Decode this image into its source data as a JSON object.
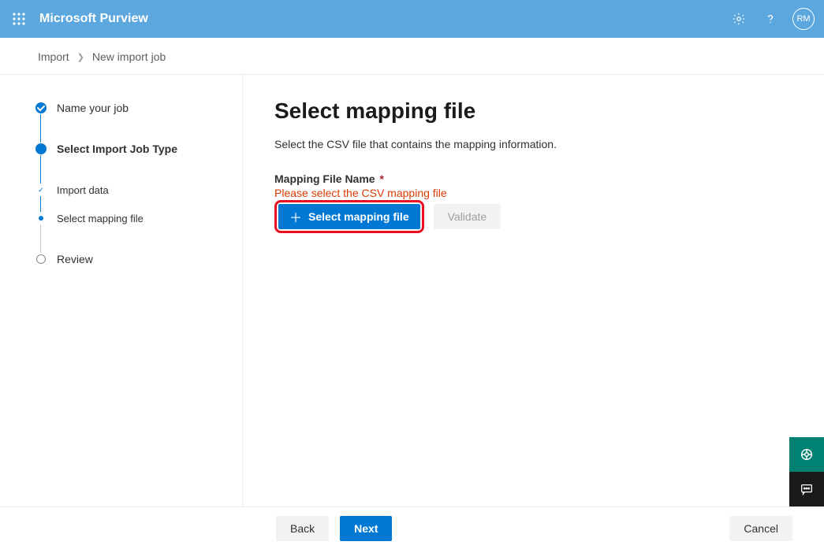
{
  "header": {
    "product": "Microsoft Purview",
    "avatar_initials": "RM"
  },
  "breadcrumb": {
    "root": "Import",
    "current": "New import job"
  },
  "stepper": {
    "step1": "Name your job",
    "step2": "Select Import Job Type",
    "step3": "Import data",
    "step4": "Select mapping file",
    "step5": "Review"
  },
  "main": {
    "title": "Select mapping file",
    "description": "Select the CSV file that contains the mapping information.",
    "field_label": "Mapping File Name",
    "error": "Please select the CSV mapping file",
    "select_btn": "Select mapping file",
    "validate_btn": "Validate"
  },
  "footer": {
    "back": "Back",
    "next": "Next",
    "cancel": "Cancel"
  }
}
